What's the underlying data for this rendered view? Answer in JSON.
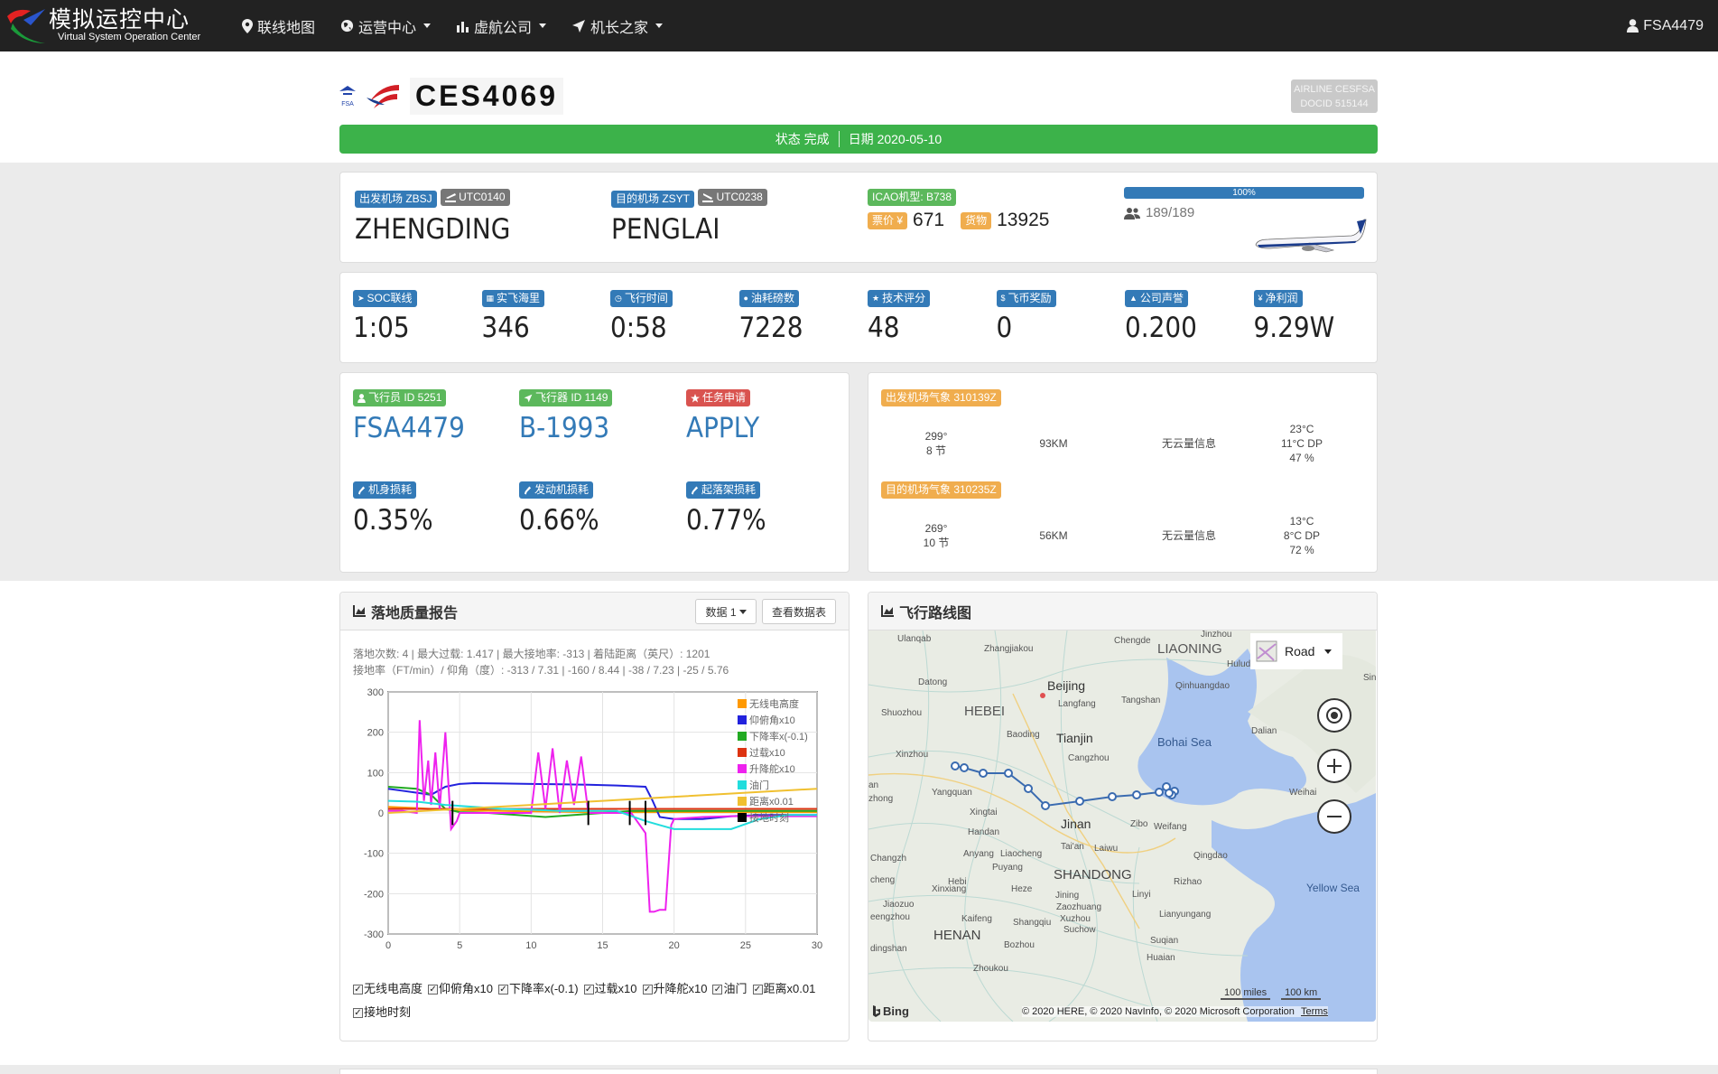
{
  "nav": {
    "logo_title": "模拟运控中心",
    "logo_subtitle": "Virtual System Operation Center",
    "items": [
      "联线地图",
      "运营中心",
      "虚航公司",
      "机长之家"
    ],
    "user": "FSA4479"
  },
  "header": {
    "fsa_label": "FSA",
    "flight_no": "CES4069",
    "airline_line1": "AIRLINE CESFSA",
    "airline_line2": "DOCID 515144",
    "status": "状态 完成",
    "date": "日期 2020-05-10"
  },
  "route": {
    "dep_badge": "出发机场 ZBSJ",
    "dep_utc": "UTC0140",
    "dep_name": "ZHENGDING",
    "arr_badge": "目的机场 ZSYT",
    "arr_utc": "UTC0238",
    "arr_name": "PENGLAI",
    "type_badge": "ICAO机型: B738",
    "fare_label": "票价 ¥",
    "fare": "671",
    "cargo_label": "货物",
    "cargo": "13925",
    "load_pct_label": "100%",
    "load_pct": 1.0,
    "pax": "189/189"
  },
  "stats": [
    {
      "label": "SOC联线",
      "value": "1:05"
    },
    {
      "label": "实飞海里",
      "value": "346"
    },
    {
      "label": "飞行时间",
      "value": "0:58"
    },
    {
      "label": "油耗磅数",
      "value": "7228"
    },
    {
      "label": "技术评分",
      "value": "48"
    },
    {
      "label": "飞币奖励",
      "value": "0"
    },
    {
      "label": "公司声誉",
      "value": "0.200"
    },
    {
      "label": "净利润",
      "value": "9.29W"
    }
  ],
  "crew": {
    "pilot_badge": "飞行员 ID 5251",
    "pilot": "FSA4479",
    "aircraft_badge": "飞行器 ID 1149",
    "aircraft": "B-1993",
    "task_badge": "任务申请",
    "task": "APPLY",
    "body_badge": "机身损耗",
    "body": "0.35%",
    "engine_badge": "发动机损耗",
    "engine": "0.66%",
    "gear_badge": "起落架损耗",
    "gear": "0.77%"
  },
  "weather": {
    "dep_badge": "出发机场气象 310139Z",
    "dep_wind1": "299°",
    "dep_wind2": "8 节",
    "dep_vis": "93KM",
    "dep_cloud": "无云量信息",
    "dep_t1": "23°C",
    "dep_t2": "11°C DP",
    "dep_t3": "47 %",
    "arr_badge": "目的机场气象 310235Z",
    "arr_wind1": "269°",
    "arr_wind2": "10 节",
    "arr_vis": "56KM",
    "arr_cloud": "无云量信息",
    "arr_t1": "13°C",
    "arr_t2": "8°C DP",
    "arr_t3": "72 %"
  },
  "landing": {
    "title": "落地质量报告",
    "btn_data": "数据 1",
    "btn_table": "查看数据表",
    "info1": "落地次数: 4 | 最大过载: 1.417 | 最大接地率: -313 | 着陆距离（英尺）: 1201",
    "info2": "接地率（FT/min）/ 仰角（度）: -313 / 7.31 | -160 / 8.44 | -38 / 7.23 | -25 / 5.76",
    "checkboxes": [
      "无线电高度",
      "仰俯角x10",
      "下降率x(-0.1)",
      "过载x10",
      "升降舵x10",
      "油门",
      "距离x0.01",
      "接地时刻"
    ]
  },
  "chart_data": {
    "type": "line",
    "xlim": [
      0,
      30
    ],
    "ylim": [
      -300,
      300
    ],
    "xticks": [
      0,
      5,
      10,
      15,
      20,
      25,
      30
    ],
    "yticks": [
      300,
      200,
      100,
      0,
      -100,
      -200,
      -300
    ],
    "legend_position": "top-right",
    "series": [
      {
        "name": "无线电高度",
        "color": "#ff9900",
        "x": [
          0,
          2,
          4,
          6,
          8,
          10,
          12,
          14,
          16,
          18,
          20,
          22,
          24,
          26,
          28,
          30
        ],
        "y": [
          15,
          12,
          8,
          6,
          5,
          4,
          3,
          2,
          2,
          2,
          2,
          2,
          2,
          2,
          2,
          2
        ]
      },
      {
        "name": "仰俯角x10",
        "color": "#2222dd",
        "x": [
          0,
          1,
          2,
          3,
          4,
          5,
          6,
          8,
          10,
          12,
          14,
          16,
          18,
          18.5,
          19,
          20,
          22,
          24,
          26,
          28,
          30
        ],
        "y": [
          60,
          55,
          50,
          45,
          65,
          72,
          74,
          73,
          72,
          71,
          70,
          68,
          65,
          30,
          -10,
          -15,
          -15,
          -8,
          -5,
          -5,
          -5
        ]
      },
      {
        "name": "下降率x(-0.1)",
        "color": "#22aa22",
        "x": [
          0,
          2,
          3,
          4,
          5,
          7,
          9,
          11,
          13,
          15,
          17,
          19,
          21,
          23,
          25,
          27,
          30
        ],
        "y": [
          65,
          60,
          45,
          10,
          2,
          0,
          -5,
          -10,
          -5,
          0,
          5,
          5,
          5,
          5,
          5,
          5,
          5
        ]
      },
      {
        "name": "过载x10",
        "color": "#dd3311",
        "x": [
          0,
          5,
          10,
          15,
          20,
          25,
          30
        ],
        "y": [
          10,
          10,
          10,
          10,
          10,
          10,
          10
        ]
      },
      {
        "name": "升降舵x10",
        "color": "#ee22ee",
        "x": [
          0,
          1,
          2,
          2.2,
          2.5,
          2.8,
          3,
          3.3,
          3.6,
          4,
          4.4,
          4.8,
          5,
          6,
          8,
          10,
          10.5,
          11,
          11.5,
          12,
          12.5,
          13,
          13.5,
          14,
          15,
          17,
          18,
          18.3,
          18.6,
          19,
          19.4,
          19.8,
          20,
          22,
          24,
          26,
          28,
          30
        ],
        "y": [
          5,
          5,
          0,
          230,
          30,
          130,
          20,
          150,
          10,
          200,
          -40,
          -20,
          0,
          0,
          0,
          0,
          150,
          10,
          160,
          0,
          130,
          20,
          140,
          0,
          0,
          0,
          -50,
          -245,
          -245,
          -240,
          -240,
          -30,
          -15,
          -10,
          -8,
          -8,
          -8,
          -8
        ]
      },
      {
        "name": "油门",
        "color": "#22dddd",
        "x": [
          0,
          2,
          4,
          6,
          8,
          10,
          12,
          14,
          16,
          18,
          19,
          20,
          22,
          24,
          26,
          28,
          30
        ],
        "y": [
          30,
          28,
          20,
          15,
          10,
          8,
          5,
          5,
          5,
          -20,
          -30,
          -40,
          -40,
          -40,
          -15,
          -5,
          -5
        ]
      },
      {
        "name": "距离x0.01",
        "color": "#f0c030",
        "x": [
          0,
          5,
          10,
          15,
          20,
          25,
          30
        ],
        "y": [
          0,
          10,
          20,
          30,
          40,
          50,
          60
        ]
      },
      {
        "name": "接地时刻",
        "color": "#000000",
        "x": [
          2,
          14
        ],
        "y": [
          0,
          0
        ]
      }
    ],
    "touchdowns": [
      4.5,
      14.0,
      16.9,
      18.0
    ]
  },
  "route_map": {
    "title": "飞行路线图",
    "map_style": "Road",
    "scale_miles": "100 miles",
    "scale_km": "100 km",
    "credits": "© 2020 HERE, © 2020 NavInfo, © 2020 Microsoft Corporation",
    "terms": "Terms",
    "bing": "Bing",
    "labels": [
      {
        "t": "Ulanqab",
        "c": "#555"
      },
      {
        "t": "Zhangjiakou",
        "c": "#555"
      },
      {
        "t": "Chengde",
        "c": "#555"
      },
      {
        "t": "Jinzhou",
        "c": "#555"
      },
      {
        "t": "LIAONING",
        "c": "#555"
      },
      {
        "t": "Hulud",
        "c": "#555"
      },
      {
        "t": "Datong",
        "c": "#555"
      },
      {
        "t": "Beijing",
        "c": "#333"
      },
      {
        "t": "Qinhuangdao",
        "c": "#555"
      },
      {
        "t": "Shuozhou",
        "c": "#555"
      },
      {
        "t": "HEBEI",
        "c": "#555"
      },
      {
        "t": "Langfang",
        "c": "#555"
      },
      {
        "t": "Tangshan",
        "c": "#555"
      },
      {
        "t": "Dalian",
        "c": "#555"
      },
      {
        "t": "Baoding",
        "c": "#555"
      },
      {
        "t": "Tianjin",
        "c": "#333"
      },
      {
        "t": "Xinzhou",
        "c": "#555"
      },
      {
        "t": "Cangzhou",
        "c": "#555"
      },
      {
        "t": "Bohai Sea",
        "c": "#34598f"
      },
      {
        "t": "Yangquan",
        "c": "#555"
      },
      {
        "t": "Weihai",
        "c": "#555"
      },
      {
        "t": "Xingtai",
        "c": "#555"
      },
      {
        "t": "Jinan",
        "c": "#333"
      },
      {
        "t": "Zibo",
        "c": "#555"
      },
      {
        "t": "Weifang",
        "c": "#555"
      },
      {
        "t": "Handan",
        "c": "#555"
      },
      {
        "t": "Anyang",
        "c": "#555"
      },
      {
        "t": "Liaocheng",
        "c": "#555"
      },
      {
        "t": "Tai'an",
        "c": "#555"
      },
      {
        "t": "Laiwu",
        "c": "#555"
      },
      {
        "t": "Qingdao",
        "c": "#555"
      },
      {
        "t": "Puyang",
        "c": "#555"
      },
      {
        "t": "SHANDONG",
        "c": "#444"
      },
      {
        "t": "Rizhao",
        "c": "#555"
      },
      {
        "t": "Hebi",
        "c": "#555"
      },
      {
        "t": "Heze",
        "c": "#555"
      },
      {
        "t": "Jining",
        "c": "#555"
      },
      {
        "t": "Linyi",
        "c": "#555"
      },
      {
        "t": "Yellow Sea",
        "c": "#34598f"
      },
      {
        "t": "Xinxiang",
        "c": "#555"
      },
      {
        "t": "Zaozhuang",
        "c": "#555"
      },
      {
        "t": "Jiaozuo",
        "c": "#555"
      },
      {
        "t": "Lianyungang",
        "c": "#555"
      },
      {
        "t": "Kaifeng",
        "c": "#555"
      },
      {
        "t": "Shangqiu",
        "c": "#555"
      },
      {
        "t": "Xuzhou",
        "c": "#555"
      },
      {
        "t": "Suchow",
        "c": "#555"
      },
      {
        "t": "HENAN",
        "c": "#444"
      },
      {
        "t": "Bozhou",
        "c": "#555"
      },
      {
        "t": "Suqian",
        "c": "#555"
      },
      {
        "t": "Zhoukou",
        "c": "#555"
      },
      {
        "t": "Huaian",
        "c": "#555"
      },
      {
        "t": "Changzh",
        "c": "#555"
      },
      {
        "t": "eengzhou",
        "c": "#555"
      },
      {
        "t": "cheng",
        "c": "#555"
      },
      {
        "t": "dingshan",
        "c": "#555"
      },
      {
        "t": "Sino",
        "c": "#555"
      },
      {
        "t": "an",
        "c": "#555"
      },
      {
        "t": "zhong",
        "c": "#555"
      }
    ]
  }
}
